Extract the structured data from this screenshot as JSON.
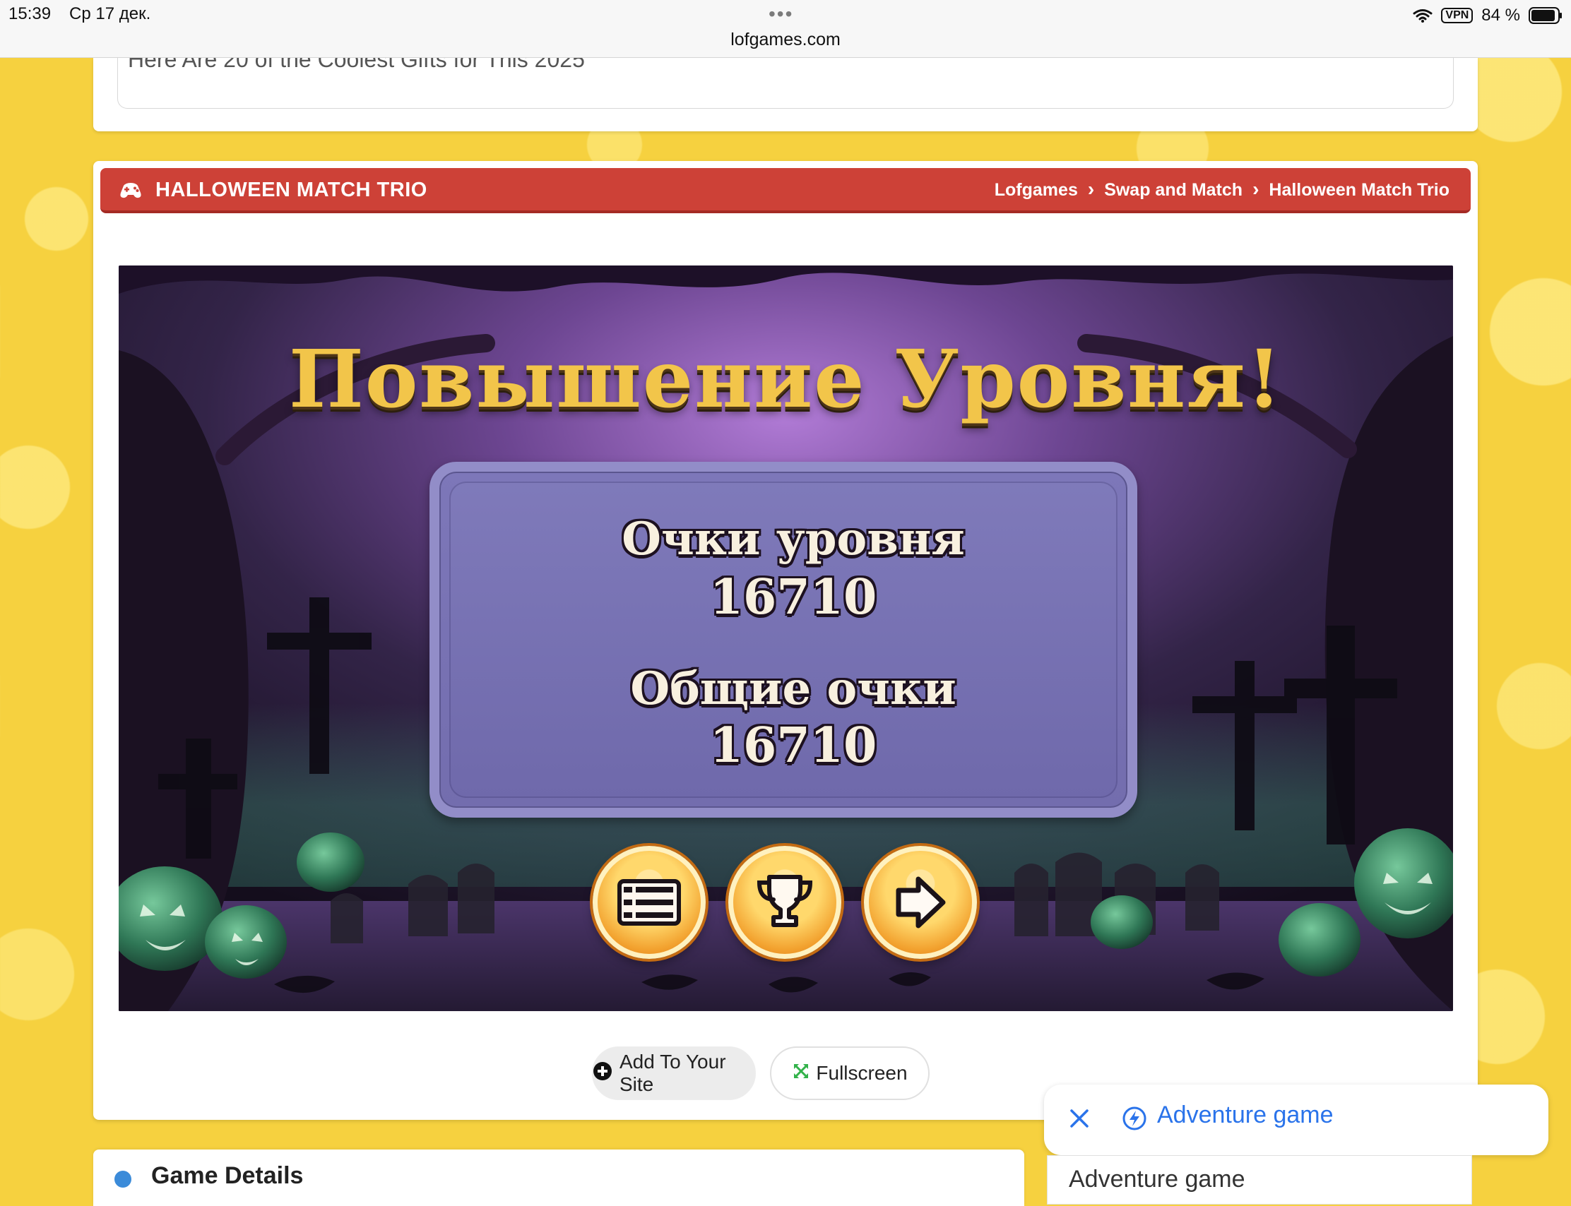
{
  "status_bar": {
    "time": "15:39",
    "date": "Ср 17 дек.",
    "dots": "•••",
    "url": "lofgames.com",
    "vpn": "VPN",
    "battery": "84 %"
  },
  "top_card": {
    "text": "Here Are 20 of the Coolest Gifts for This 2025"
  },
  "game_header": {
    "title": "HALLOWEEN MATCH TRIO",
    "breadcrumb": [
      "Lofgames",
      "Swap and Match",
      "Halloween Match Trio"
    ],
    "separator": "›",
    "header_color": "#cd4137"
  },
  "game": {
    "level_up_title": "Повышение Уровня!",
    "level_score_label": "Очки уровня",
    "level_score_value": "16710",
    "total_score_label": "Общие очки",
    "total_score_value": "16710",
    "buttons": [
      {
        "icon": "menu-icon"
      },
      {
        "icon": "trophy-icon"
      },
      {
        "icon": "arrow-right-icon"
      }
    ]
  },
  "actions": {
    "add_to_site": "Add To Your Site",
    "fullscreen": "Fullscreen"
  },
  "ad": {
    "label": "Adventure game"
  },
  "bottom": {
    "left_text": "Game Details",
    "right_text": "Adventure game"
  }
}
